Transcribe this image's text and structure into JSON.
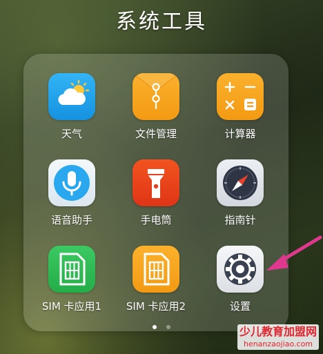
{
  "folder": {
    "title": "系统工具"
  },
  "apps": [
    {
      "label": "天气",
      "icon": "weather-icon"
    },
    {
      "label": "文件管理",
      "icon": "file-manager-icon"
    },
    {
      "label": "计算器",
      "icon": "calculator-icon"
    },
    {
      "label": "语音助手",
      "icon": "voice-assistant-icon"
    },
    {
      "label": "手电筒",
      "icon": "flashlight-icon"
    },
    {
      "label": "指南针",
      "icon": "compass-icon"
    },
    {
      "label": "SIM 卡应用1",
      "icon": "sim-card-icon"
    },
    {
      "label": "SIM 卡应用2",
      "icon": "sim-card-icon"
    },
    {
      "label": "设置",
      "icon": "settings-gear-icon"
    }
  ],
  "pager": {
    "pages": 2,
    "current": 1
  },
  "annotation": {
    "arrow_color": "#e0388f",
    "points_to": "settings"
  },
  "watermark": {
    "line1": "少儿教育加盟网",
    "line2": "henanzaojiao.com"
  },
  "colors": {
    "weather": "#1fa3ee",
    "file_manager": "#f7a31c",
    "calculator": "#f7a31c",
    "voice_assistant": "#e9f1f7",
    "flashlight": "#e8401d",
    "compass": "#dfe3e8",
    "sim1": "#2fbc55",
    "sim2": "#f7a31c",
    "settings": "#eef0f3"
  }
}
